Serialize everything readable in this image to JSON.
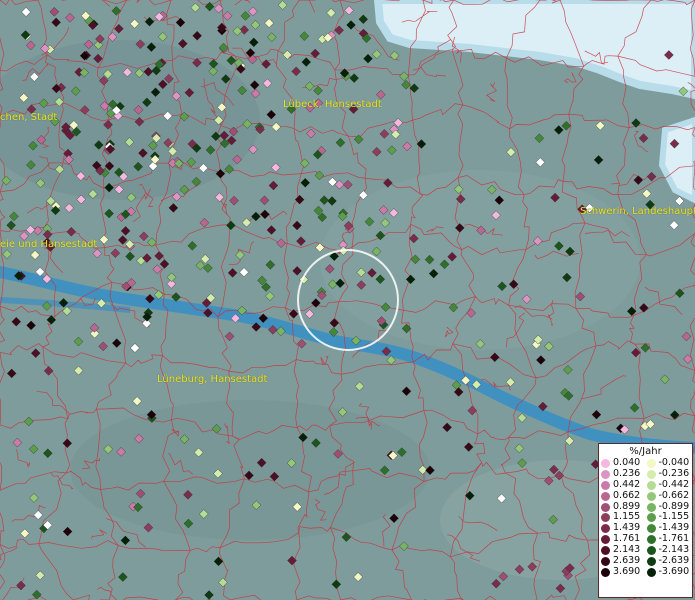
{
  "map": {
    "cities": [
      {
        "id": "luebeck",
        "name": "Lübeck, Hansestadt"
      },
      {
        "id": "schwerin",
        "name": "Schwerin, Landeshaupt"
      },
      {
        "id": "lueneburg",
        "name": "Lüneburg, Hansestadt"
      },
      {
        "id": "kiel",
        "name": "chen, Stadt"
      },
      {
        "id": "hamburg",
        "name": "eie und Hansestadt"
      }
    ],
    "colors": {
      "land": "#7f9c9c",
      "water": "#dceef6",
      "river": "#3a8fc4",
      "boundaries": "#c8323c",
      "label": "#e6e61e",
      "marker_highlight": "#ffffff"
    }
  },
  "legend": {
    "title": "%/Jahr",
    "positive": [
      {
        "value": "0.040",
        "color": "#f4b8e0"
      },
      {
        "value": "0.236",
        "color": "#dd94c4"
      },
      {
        "value": "0.442",
        "color": "#cc7aa8"
      },
      {
        "value": "0.662",
        "color": "#b86890"
      },
      {
        "value": "0.899",
        "color": "#a04f74"
      },
      {
        "value": "1.155",
        "color": "#8e3d5e"
      },
      {
        "value": "1.439",
        "color": "#7a2c4a"
      },
      {
        "value": "1.761",
        "color": "#661c38"
      },
      {
        "value": "2.143",
        "color": "#4d1026"
      },
      {
        "value": "2.639",
        "color": "#360818"
      },
      {
        "value": "3.690",
        "color": "#1c0208"
      }
    ],
    "negative": [
      {
        "value": "-0.040",
        "color": "#f4f8c4"
      },
      {
        "value": "-0.236",
        "color": "#d4ecac"
      },
      {
        "value": "-0.442",
        "color": "#b4dc94"
      },
      {
        "value": "-0.662",
        "color": "#94c878"
      },
      {
        "value": "-0.899",
        "color": "#78b464"
      },
      {
        "value": "-1.155",
        "color": "#5c9e4c"
      },
      {
        "value": "-1.439",
        "color": "#44883a"
      },
      {
        "value": "-1.761",
        "color": "#2e702a"
      },
      {
        "value": "-2.143",
        "color": "#1c561c"
      },
      {
        "value": "-2.639",
        "color": "#0e3c10"
      },
      {
        "value": "-3.690",
        "color": "#042008"
      }
    ]
  }
}
